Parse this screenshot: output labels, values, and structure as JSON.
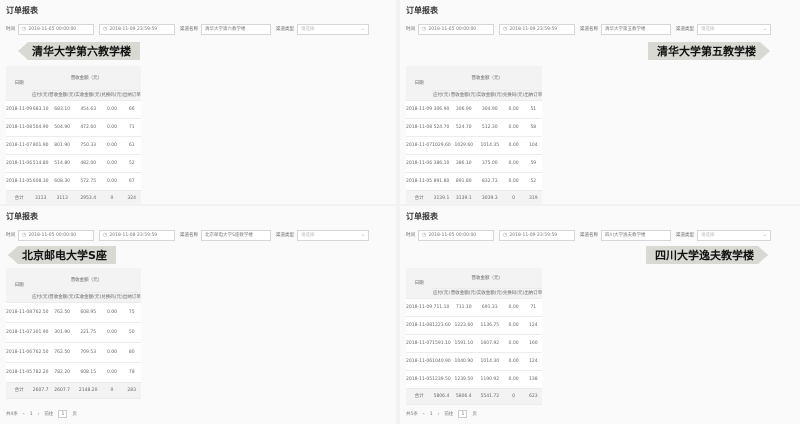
{
  "panels": [
    {
      "title": "订单报表",
      "filters": {
        "time_label": "时间",
        "start": "2018-11-05 00:00:00",
        "end": "2018-11-09 23:59:59",
        "channel_name_label": "渠道名称",
        "channel_name": "清华大学第六教学楼",
        "channel_type_label": "渠道类型",
        "channel_type_placeholder": "请选择"
      },
      "banner": "清华大学第六教学楼",
      "table": {
        "date_header": "日期",
        "group_header": "营收金额（元）",
        "columns": [
          "应付(元)",
          "营收金额(元)",
          "实收金额(元)",
          "兑换码(元)",
          "出纳订单"
        ],
        "rows": [
          {
            "date": "2018-11-09",
            "values": [
              "683.10",
              "683.10",
              "454.63",
              "0.00",
              "66"
            ]
          },
          {
            "date": "2018-11-08",
            "values": [
              "504.90",
              "504.90",
              "472.60",
              "0.00",
              "71"
            ]
          },
          {
            "date": "2018-11-07",
            "values": [
              "801.90",
              "801.90",
              "750.33",
              "0.00",
              "61"
            ]
          },
          {
            "date": "2018-11-06",
            "values": [
              "514.80",
              "514.80",
              "482.00",
              "0.00",
              "52"
            ]
          },
          {
            "date": "2018-11-05",
            "values": [
              "608.30",
              "608.30",
              "572.75",
              "0.00",
              "67"
            ]
          }
        ],
        "total": {
          "label": "合计",
          "values": [
            "3113",
            "3113",
            "2953.4",
            "0",
            "324"
          ]
        }
      }
    },
    {
      "title": "订单报表",
      "filters": {
        "time_label": "时间",
        "start": "2018-11-05 00:00:00",
        "end": "2018-11-09 23:59:59",
        "channel_name_label": "渠道名称",
        "channel_name": "清华大学第五教学楼",
        "channel_type_label": "渠道类型",
        "channel_type_placeholder": "请选择"
      },
      "banner": "清华大学第五教学楼",
      "table": {
        "date_header": "日期",
        "group_header": "营收金额（元）",
        "columns": [
          "应付(元)",
          "营收金额(元)",
          "实收金额(元)",
          "兑换码(元)",
          "出纳订单"
        ],
        "rows": [
          {
            "date": "2018-11-09",
            "values": [
              "306.90",
              "306.90",
              "304.90",
              "0.00",
              "51"
            ]
          },
          {
            "date": "2018-11-08",
            "values": [
              "524.70",
              "524.70",
              "512.30",
              "0.00",
              "58"
            ]
          },
          {
            "date": "2018-11-07",
            "values": [
              "1029.60",
              "1029.60",
              "1014.35",
              "0.00",
              "104"
            ]
          },
          {
            "date": "2018-11-06",
            "values": [
              "386.10",
              "386.10",
              "375.00",
              "0.00",
              "59"
            ]
          },
          {
            "date": "2018-11-05",
            "values": [
              "891.80",
              "891.80",
              "832.73",
              "0.00",
              "52"
            ]
          }
        ],
        "total": {
          "label": "合计",
          "values": [
            "3139.1",
            "3139.1",
            "3039.3",
            "0",
            "319"
          ]
        }
      }
    },
    {
      "title": "订单报表",
      "filters": {
        "time_label": "时间",
        "start": "2018-11-05 00:00:00",
        "end": "2018-11-08 23:59:59",
        "channel_name_label": "渠道名称",
        "channel_name": "北京邮电大学S座教学楼",
        "channel_type_label": "渠道类型",
        "channel_type_placeholder": "请选择"
      },
      "banner": "北京邮电大学S座",
      "table": {
        "date_header": "日期",
        "group_header": "营收金额（元）",
        "columns": [
          "应付(元)",
          "营收金额(元)",
          "实收金额(元)",
          "兑换码(元)",
          "出纳订单"
        ],
        "rows": [
          {
            "date": "2018-11-08",
            "values": [
              "762.50",
              "762.50",
              "608.95",
              "0.00",
              "75"
            ]
          },
          {
            "date": "2018-11-07",
            "values": [
              "301.90",
              "301.90",
              "221.75",
              "0.00",
              "50"
            ]
          },
          {
            "date": "2018-11-06",
            "values": [
              "762.50",
              "762.50",
              "709.53",
              "0.00",
              "80"
            ]
          },
          {
            "date": "2018-11-05",
            "values": [
              "782.20",
              "782.20",
              "608.15",
              "0.00",
              "78"
            ]
          }
        ],
        "total": {
          "label": "合计",
          "values": [
            "2607.7",
            "2607.7",
            "2148.20",
            "0",
            "283"
          ]
        }
      },
      "pager": {
        "total": "共4条",
        "page": "1",
        "goto_label": "前往",
        "goto_value": "1",
        "page_suffix": "页"
      }
    },
    {
      "title": "订单报表",
      "filters": {
        "time_label": "时间",
        "start": "2018-11-05 00:00:00",
        "end": "2018-11-09 23:59:59",
        "channel_name_label": "渠道名称",
        "channel_name": "四川大学逸夫教学楼",
        "channel_type_label": "渠道类型",
        "channel_type_placeholder": "请选择"
      },
      "banner": "四川大学逸夫教学楼",
      "table": {
        "date_header": "日期",
        "group_header": "营收金额（元）",
        "columns": [
          "应付(元)",
          "营收金额(元)",
          "实收金额(元)",
          "兑换码(元)",
          "出纳订单"
        ],
        "rows": [
          {
            "date": "2018-11-09",
            "values": [
              "711.10",
              "711.10",
              "691.33",
              "0.00",
              "71"
            ]
          },
          {
            "date": "2018-11-08",
            "values": [
              "1223.60",
              "1223.60",
              "1136.75",
              "0.00",
              "124"
            ]
          },
          {
            "date": "2018-11-07",
            "values": [
              "1591.10",
              "1591.10",
              "1607.92",
              "0.00",
              "160"
            ]
          },
          {
            "date": "2018-11-06",
            "values": [
              "1040.90",
              "1040.90",
              "1014.30",
              "0.00",
              "124"
            ]
          },
          {
            "date": "2018-11-05",
            "values": [
              "1239.50",
              "1239.50",
              "1190.92",
              "0.00",
              "138"
            ]
          }
        ],
        "total": {
          "label": "合计",
          "values": [
            "5806.4",
            "5806.4",
            "5541.72",
            "0",
            "623"
          ]
        }
      },
      "pager": {
        "total": "共5条",
        "page": "1",
        "goto_label": "前往",
        "goto_value": "1",
        "page_suffix": "页"
      }
    }
  ]
}
